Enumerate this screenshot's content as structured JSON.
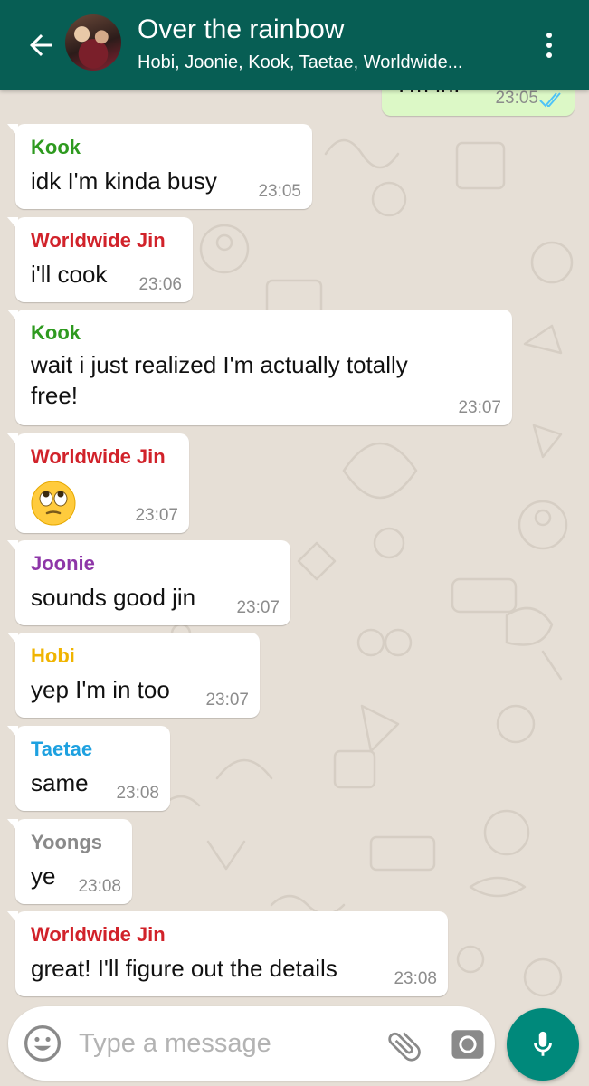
{
  "header": {
    "title": "Over the rainbow",
    "members": "Hobi, Joonie, Kook, Taetae, Worldwide..."
  },
  "colors": {
    "header_bg": "#075e54",
    "accent": "#00897b",
    "read_ticks": "#4fc3f7"
  },
  "messages": [
    {
      "direction": "out",
      "text": "I'm in!",
      "time": "23:05",
      "status": "read"
    },
    {
      "direction": "in",
      "sender": "Kook",
      "sender_color": "#2e9a1f",
      "text": "idk I'm kinda busy",
      "time": "23:05"
    },
    {
      "direction": "in",
      "sender": "Worldwide Jin",
      "sender_color": "#d1222a",
      "text": "i'll cook",
      "time": "23:06"
    },
    {
      "direction": "in",
      "sender": "Kook",
      "sender_color": "#2e9a1f",
      "text": "wait i just realized I'm actually totally free!",
      "time": "23:07"
    },
    {
      "direction": "in",
      "sender": "Worldwide Jin",
      "sender_color": "#d1222a",
      "text": "",
      "emoji": "face-with-rolling-eyes",
      "time": "23:07"
    },
    {
      "direction": "in",
      "sender": "Joonie",
      "sender_color": "#8e36a8",
      "text": "sounds good jin",
      "time": "23:07"
    },
    {
      "direction": "in",
      "sender": "Hobi",
      "sender_color": "#f0b400",
      "text": "yep I'm in too",
      "time": "23:07"
    },
    {
      "direction": "in",
      "sender": "Taetae",
      "sender_color": "#1ea1e0",
      "text": "same",
      "time": "23:08"
    },
    {
      "direction": "in",
      "sender": "Yoongs",
      "sender_color": "#8a8a8a",
      "text": "ye",
      "time": "23:08"
    },
    {
      "direction": "in",
      "sender": "Worldwide Jin",
      "sender_color": "#d1222a",
      "text": "great! I'll figure out the details",
      "time": "23:08"
    }
  ],
  "input": {
    "placeholder": "Type a message",
    "value": ""
  },
  "icons": {
    "back": "arrow-left-icon",
    "menu": "more-vertical-icon",
    "emoji": "smiley-icon",
    "attach": "paperclip-icon",
    "camera": "camera-icon",
    "mic": "microphone-icon"
  }
}
